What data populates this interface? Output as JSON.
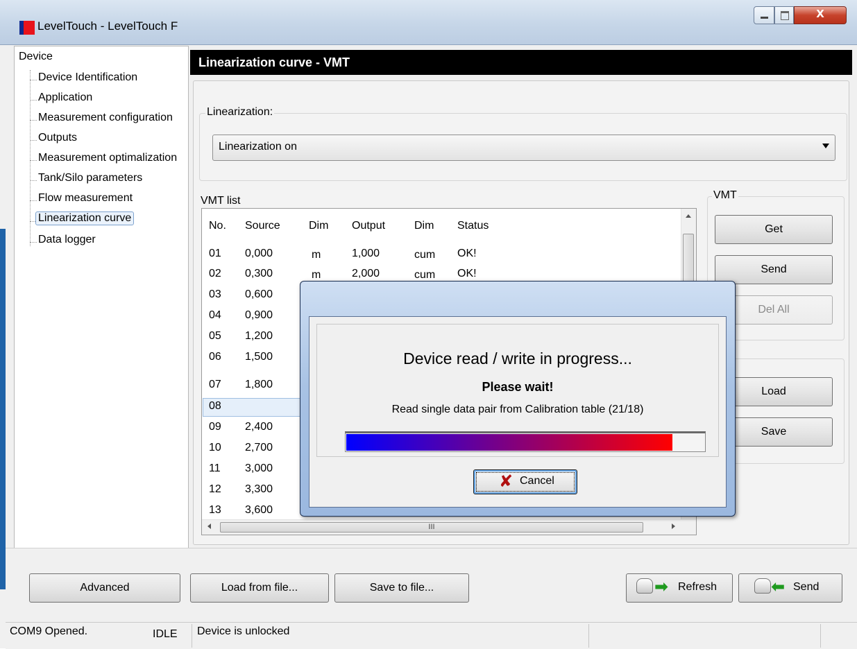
{
  "window": {
    "title": "LevelTouch - LevelTouch F",
    "close_glyph": "X"
  },
  "tree": {
    "root": "Device",
    "items": [
      "Device Identification",
      "Application",
      "Measurement configuration",
      "Outputs",
      "Measurement optimalization",
      "Tank/Silo parameters",
      "Flow measurement",
      "Linearization curve",
      "Data logger"
    ],
    "selected": "Linearization curve"
  },
  "page": {
    "header": "Linearization curve - VMT",
    "linearization_label": "Linearization:",
    "linearization_value": "Linearization on",
    "vmt_list_label": "VMT list",
    "vmt_group_label": "VMT"
  },
  "table": {
    "headers": [
      "No.",
      "Source",
      "Dim",
      "Output",
      "Dim",
      "Status"
    ],
    "rows": [
      {
        "no": "01",
        "source": "0,000",
        "dim": "m",
        "output": "1,000",
        "dim2": "cum",
        "status": "OK!"
      },
      {
        "no": "02",
        "source": "0,300",
        "dim": "m",
        "output": "2,000",
        "dim2": "cum",
        "status": "OK!"
      },
      {
        "no": "03",
        "source": "0,600"
      },
      {
        "no": "04",
        "source": "0,900"
      },
      {
        "no": "05",
        "source": "1,200"
      },
      {
        "no": "06",
        "source": "1,500"
      },
      {
        "no": "07",
        "source": "1,800"
      },
      {
        "no": "08",
        "source": ""
      },
      {
        "no": "09",
        "source": "2,400"
      },
      {
        "no": "10",
        "source": "2,700"
      },
      {
        "no": "11",
        "source": "3,000"
      },
      {
        "no": "12",
        "source": "3,300"
      },
      {
        "no": "13",
        "source": "3,600"
      }
    ],
    "selected_row": "08",
    "hscroll_grip": "III"
  },
  "vmt_buttons": {
    "get": "Get",
    "send": "Send",
    "del_all": "Del All",
    "load": "Load",
    "save": "Save"
  },
  "bottom": {
    "advanced": "Advanced",
    "load_file": "Load from file...",
    "save_file": "Save to file...",
    "refresh": "Refresh",
    "send": "Send"
  },
  "status": {
    "com": "COM9 Opened.",
    "state": "IDLE",
    "lock": "Device is unlocked"
  },
  "dialog": {
    "title": "Device read / write in progress...",
    "wait": "Please wait!",
    "message": "Read single data pair from Calibration table (21/18)",
    "progress_fraction": 0.91,
    "cancel": "Cancel"
  },
  "colors": {
    "header_bg": "#000000",
    "progress_start": "#0000ff",
    "progress_end": "#ff0000"
  }
}
